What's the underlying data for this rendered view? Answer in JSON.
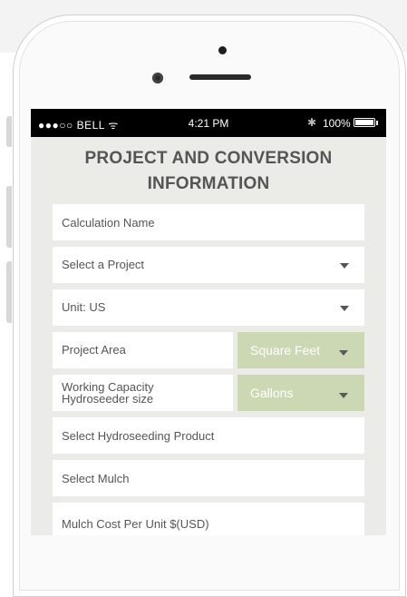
{
  "status": {
    "carrier": "●●●○○ BELL ᯤ",
    "time": "4:21 PM",
    "bluetooth": "✱",
    "battery": "100%"
  },
  "page": {
    "title_line1": "PROJECT AND CONVERSION",
    "title_line2": "INFORMATION"
  },
  "form": {
    "calculation_name": {
      "placeholder": "Calculation Name"
    },
    "project": {
      "label": "Select a Project"
    },
    "unit": {
      "label": "Unit: US"
    },
    "project_area": {
      "label": "Project Area",
      "unit": "Square Feet"
    },
    "working_capacity": {
      "label_line1": "Working Capacity",
      "label_line2": "Hydroseeder size",
      "unit": "Gallons"
    },
    "product": {
      "label": "Select Hydroseeding Product"
    },
    "mulch": {
      "label": "Select Mulch"
    },
    "mulch_cost": {
      "label": "Mulch Cost Per Unit $(USD)"
    }
  },
  "theme": {
    "accent_green": "#ccd8b3",
    "screen_bg": "#ebebe8"
  }
}
